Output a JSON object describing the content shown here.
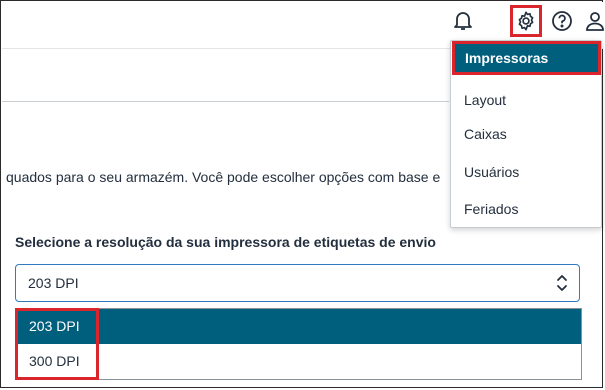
{
  "header": {
    "icons": [
      "bell-icon",
      "gear-icon",
      "help-icon",
      "user-icon"
    ]
  },
  "settings_menu": {
    "items": [
      {
        "label": "Impressoras",
        "active": true
      },
      {
        "label": "Layout"
      },
      {
        "label": "Caixas"
      },
      {
        "label": "Usuários"
      },
      {
        "label": "Feriados"
      }
    ]
  },
  "page": {
    "description": "quados para o seu armazém. Você pode escolher opções com base e",
    "select_label": "Selecione a resolução da sua impressora de etiquetas de envio",
    "select_value": "203 DPI",
    "options": [
      "203 DPI",
      "300 DPI"
    ]
  },
  "colors": {
    "accent": "#005f7d",
    "highlight": "#d9252b",
    "focus_border": "#2f7bbf"
  }
}
